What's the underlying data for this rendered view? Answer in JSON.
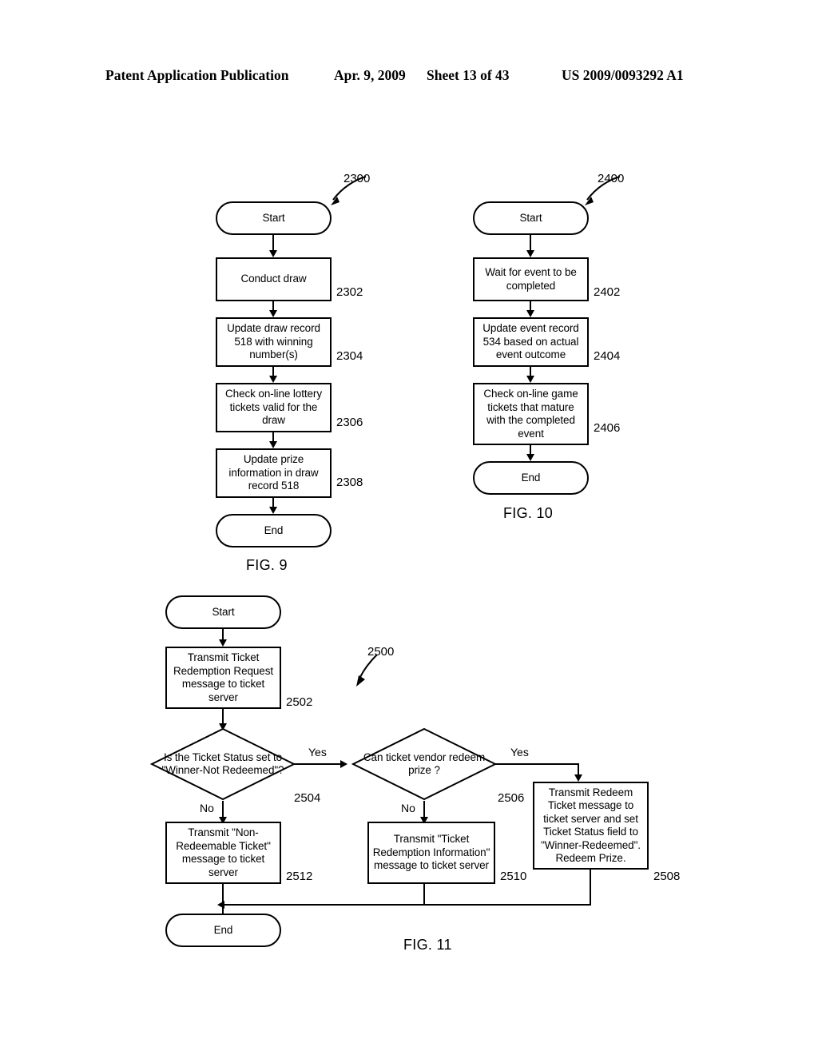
{
  "header": {
    "publication": "Patent Application Publication",
    "date": "Apr. 9, 2009",
    "sheet": "Sheet 13 of 43",
    "patent_number": "US 2009/0093292 A1"
  },
  "figures": [
    {
      "caption": "FIG. 9",
      "flow_ref": "2300",
      "nodes": [
        {
          "id": "start",
          "type": "terminal",
          "label": "Start"
        },
        {
          "id": "2302",
          "type": "process",
          "label": "Conduct draw",
          "ref": "2302"
        },
        {
          "id": "2304",
          "type": "process",
          "label": "Update draw record 518 with winning number(s)",
          "ref": "2304"
        },
        {
          "id": "2306",
          "type": "process",
          "label": "Check on-line lottery tickets valid for the draw",
          "ref": "2306"
        },
        {
          "id": "2308",
          "type": "process",
          "label": "Update prize information in draw record 518",
          "ref": "2308"
        },
        {
          "id": "end",
          "type": "terminal",
          "label": "End"
        }
      ]
    },
    {
      "caption": "FIG. 10",
      "flow_ref": "2400",
      "nodes": [
        {
          "id": "start",
          "type": "terminal",
          "label": "Start"
        },
        {
          "id": "2402",
          "type": "process",
          "label": "Wait for event to be completed",
          "ref": "2402"
        },
        {
          "id": "2404",
          "type": "process",
          "label": "Update event record 534 based on actual event outcome",
          "ref": "2404"
        },
        {
          "id": "2406",
          "type": "process",
          "label": "Check on-line game tickets that mature with the completed event",
          "ref": "2406"
        },
        {
          "id": "end",
          "type": "terminal",
          "label": "End"
        }
      ]
    },
    {
      "caption": "FIG. 11",
      "flow_ref": "2500",
      "nodes": [
        {
          "id": "start",
          "type": "terminal",
          "label": "Start"
        },
        {
          "id": "2502",
          "type": "process",
          "label": "Transmit Ticket Redemption Request message to ticket server",
          "ref": "2502"
        },
        {
          "id": "2504",
          "type": "decision",
          "label": "Is the Ticket Status set to \"Winner-Not Redeemed\"?",
          "ref": "2504",
          "yes": "Yes",
          "no": "No"
        },
        {
          "id": "2506",
          "type": "decision",
          "label": "Can ticket vendor redeem prize ?",
          "ref": "2506",
          "yes": "Yes",
          "no": "No"
        },
        {
          "id": "2508",
          "type": "process",
          "label": "Transmit Redeem Ticket message to ticket server and set Ticket Status field to \"Winner-Redeemed\". Redeem Prize.",
          "ref": "2508"
        },
        {
          "id": "2510",
          "type": "process",
          "label": "Transmit \"Ticket Redemption Information\" message to ticket server",
          "ref": "2510"
        },
        {
          "id": "2512",
          "type": "process",
          "label": "Transmit \"Non-Redeemable Ticket\" message to ticket server",
          "ref": "2512"
        },
        {
          "id": "end",
          "type": "terminal",
          "label": "End"
        }
      ]
    }
  ]
}
